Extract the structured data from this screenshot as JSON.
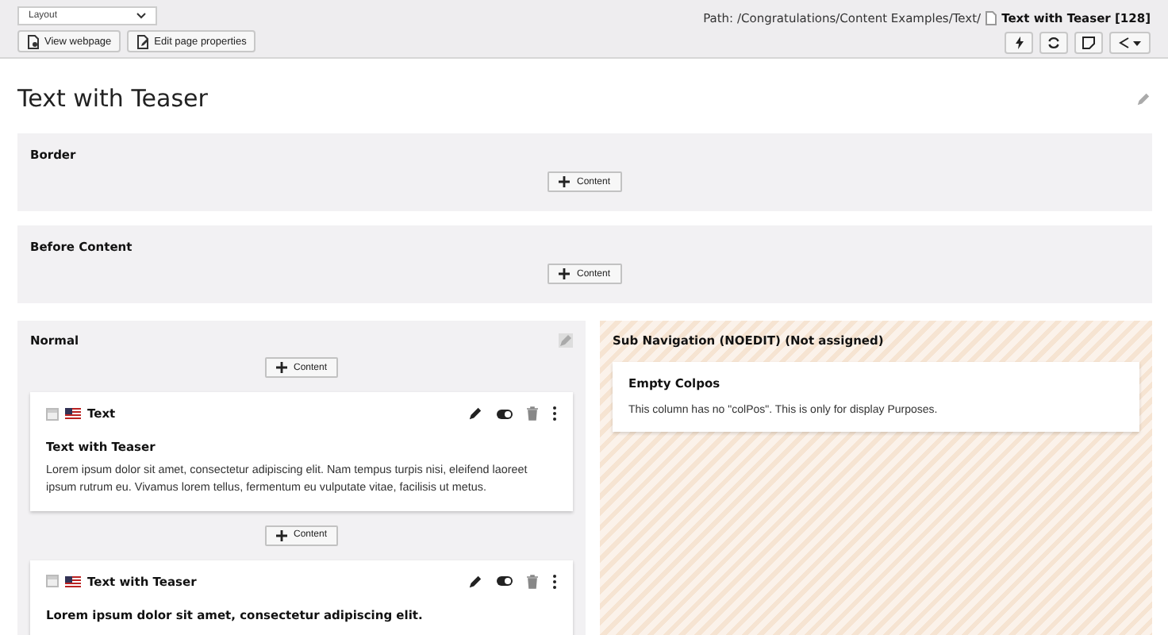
{
  "module_menu": {
    "value": "Layout"
  },
  "header_buttons": [
    "View webpage",
    "Edit page properties"
  ],
  "path": {
    "prefix": "Path: /Congratulations/Content Examples/Text/",
    "page": "Text with Teaser [128]"
  },
  "page_title": "Text with Teaser",
  "sections": [
    {
      "title": "Border",
      "add_button": "Content"
    },
    {
      "title": "Before Content",
      "add_button": "Content"
    }
  ],
  "columns": [
    {
      "kind": "normal",
      "title": "Normal",
      "add_button": "Content",
      "elements": [
        {
          "title": "Text",
          "heading": "Text with Teaser",
          "body": "Lorem ipsum dolor sit amet, consectetur adipiscing elit. Nam tempus turpis nisi, eleifend laoreet ipsum rutrum eu. Vivamus lorem tellus, fermentum eu vulputate vitae, facilisis ut metus.",
          "add_button": "Content"
        },
        {
          "title": "Text with Teaser",
          "heading": "Lorem ipsum dolor sit amet, consectetur adipiscing elit."
        }
      ]
    },
    {
      "kind": "unassigned",
      "title": "Sub Navigation (NOEDIT) (Not assigned)",
      "notice": {
        "title": "Empty Colpos",
        "text": "This column has no \"colPos\". This is only for display Purposes."
      }
    }
  ]
}
